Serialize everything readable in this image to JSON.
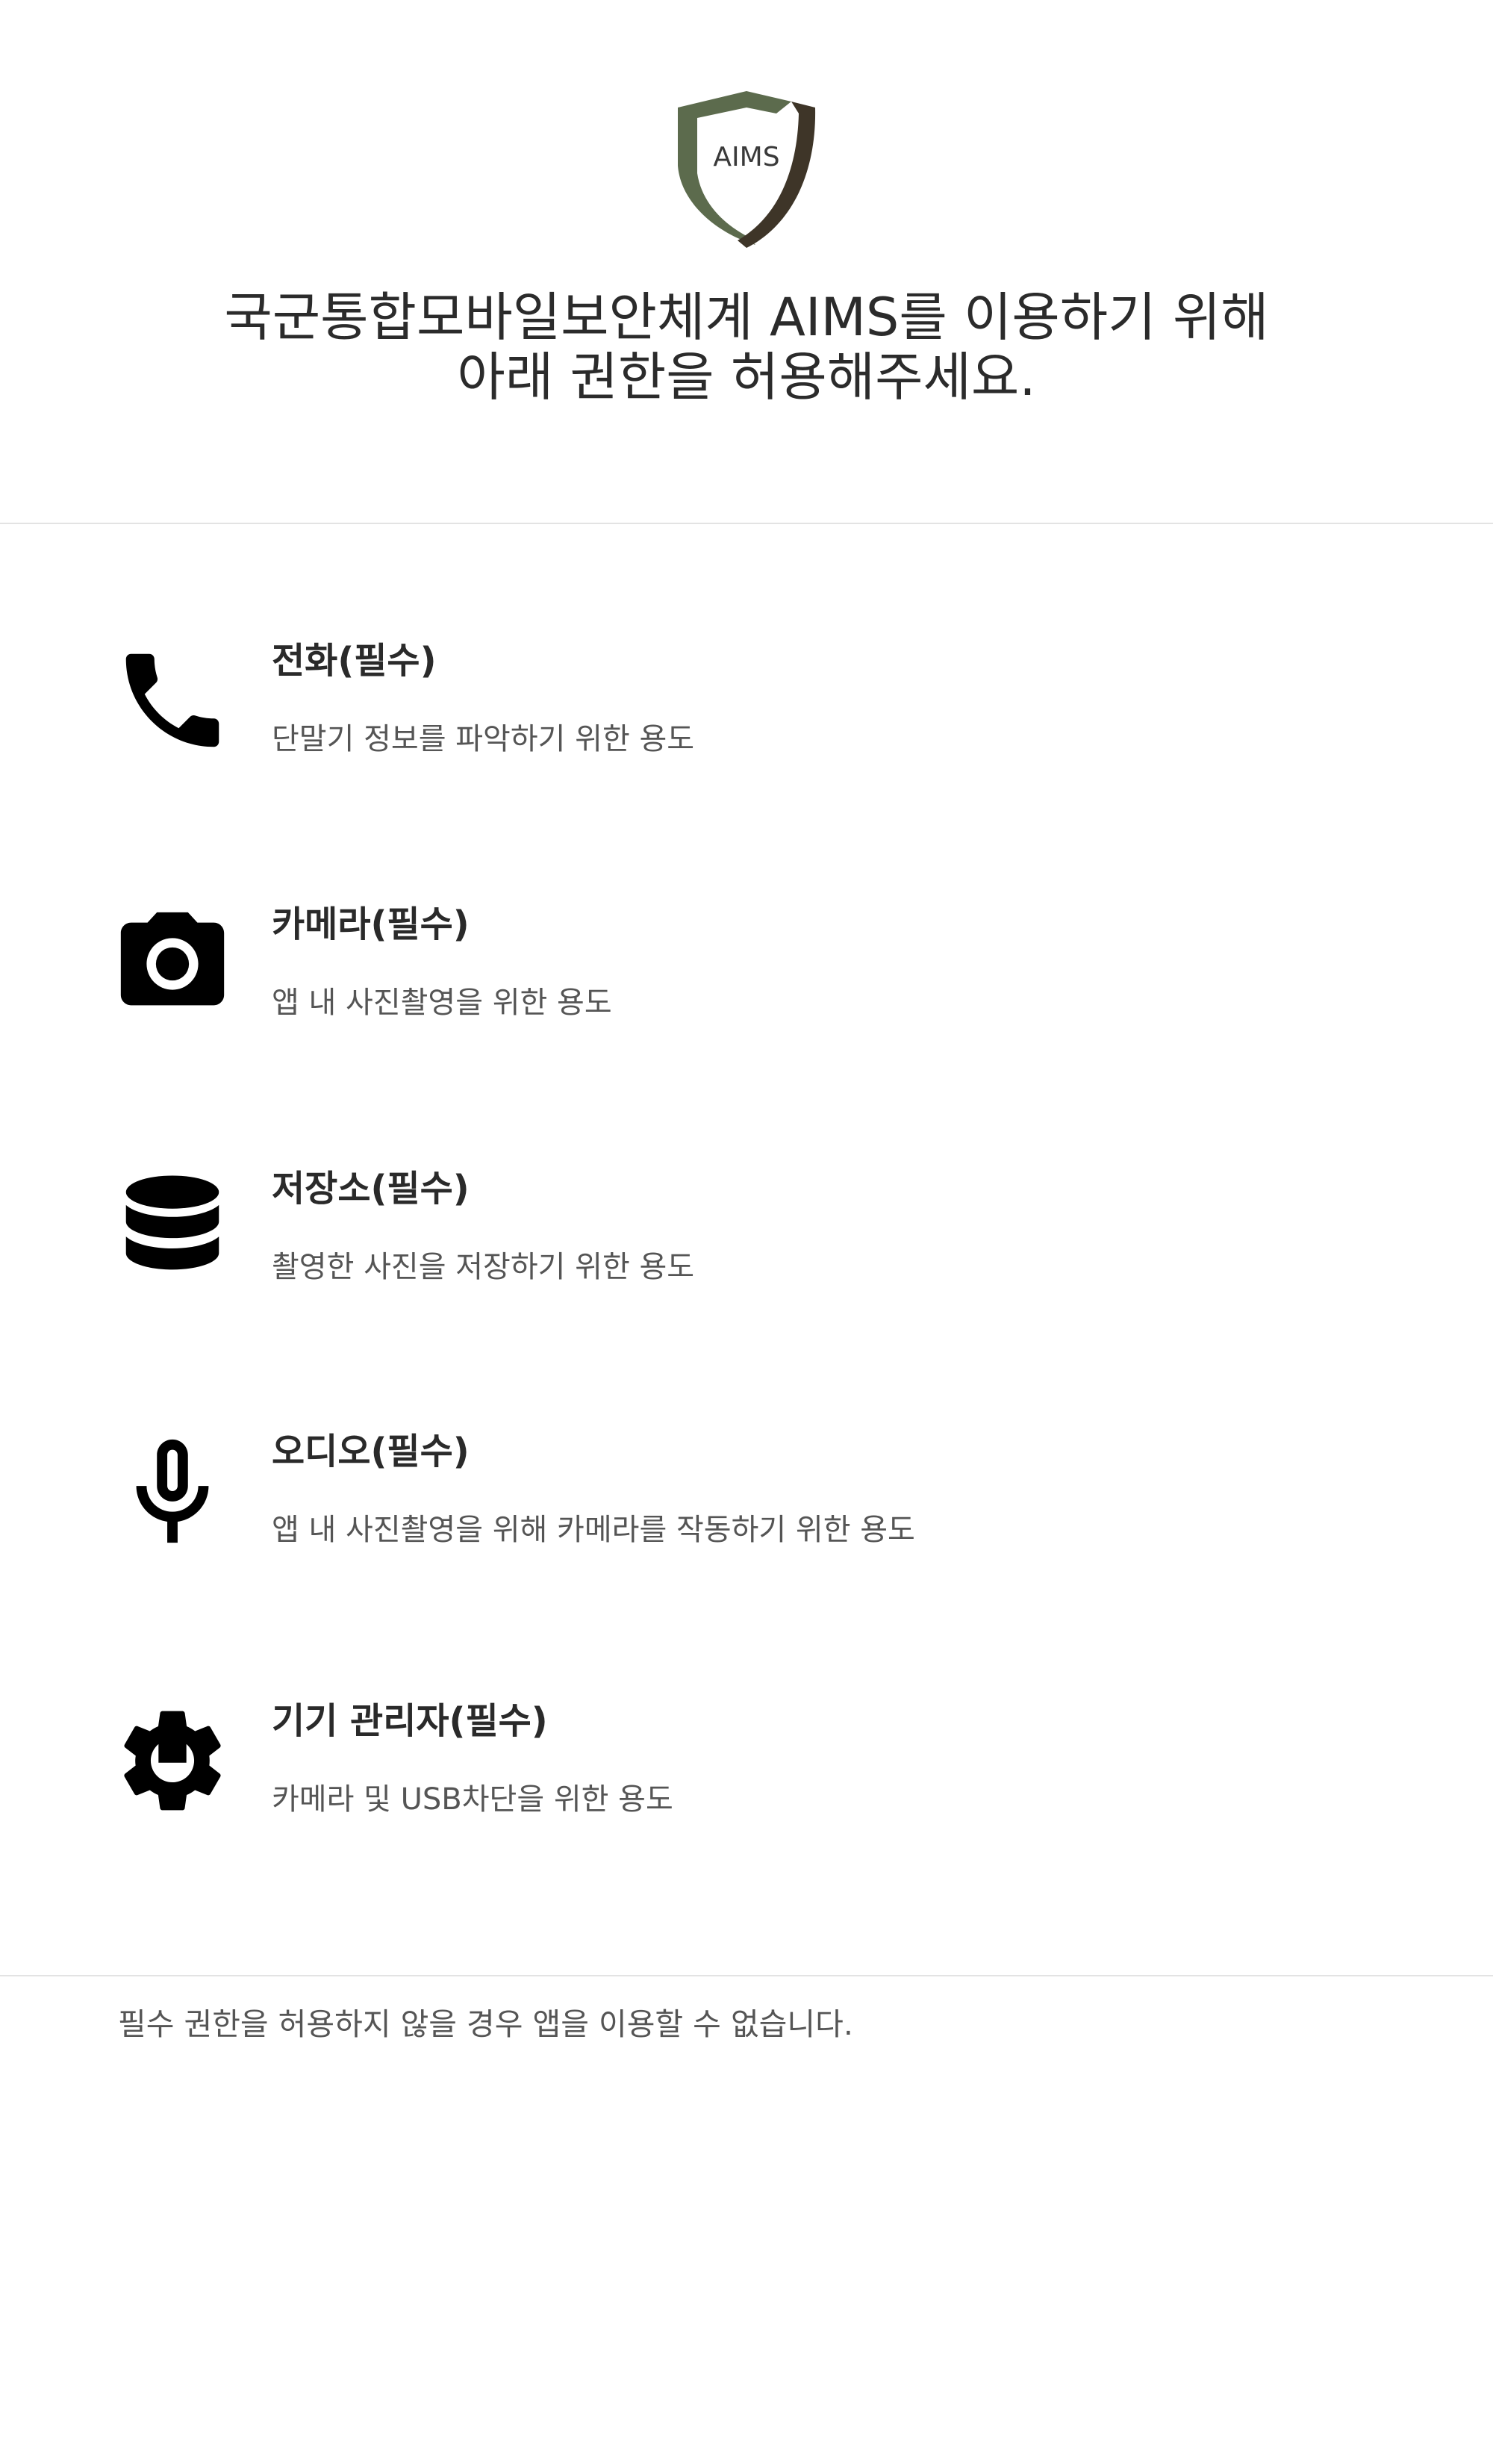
{
  "logo": {
    "text": "AIMS",
    "colors": {
      "light": "#5c6b4d",
      "dark": "#3e3528"
    }
  },
  "header": {
    "title_line1": "국군통합모바일보안체계 AIMS를 이용하기 위해",
    "title_line2": "아래 권한을 허용해주세요."
  },
  "permissions": [
    {
      "icon": "phone-icon",
      "title": "전화(필수)",
      "description": "단말기 정보를 파악하기 위한 용도"
    },
    {
      "icon": "camera-icon",
      "title": "카메라(필수)",
      "description": "앱 내 사진촬영을 위한 용도"
    },
    {
      "icon": "database-icon",
      "title": "저장소(필수)",
      "description": "촬영한 사진을 저장하기 위한 용도"
    },
    {
      "icon": "microphone-icon",
      "title": "오디오(필수)",
      "description": "앱 내 사진촬영을 위해 카메라를 작동하기 위한 용도"
    },
    {
      "icon": "device-admin-gear-icon",
      "title": "기기 관리자(필수)",
      "description": "카메라 및 USB차단을 위한 용도"
    }
  ],
  "footer": {
    "notice": "필수 권한을 허용하지 않을 경우 앱을 이용할 수 없습니다."
  }
}
